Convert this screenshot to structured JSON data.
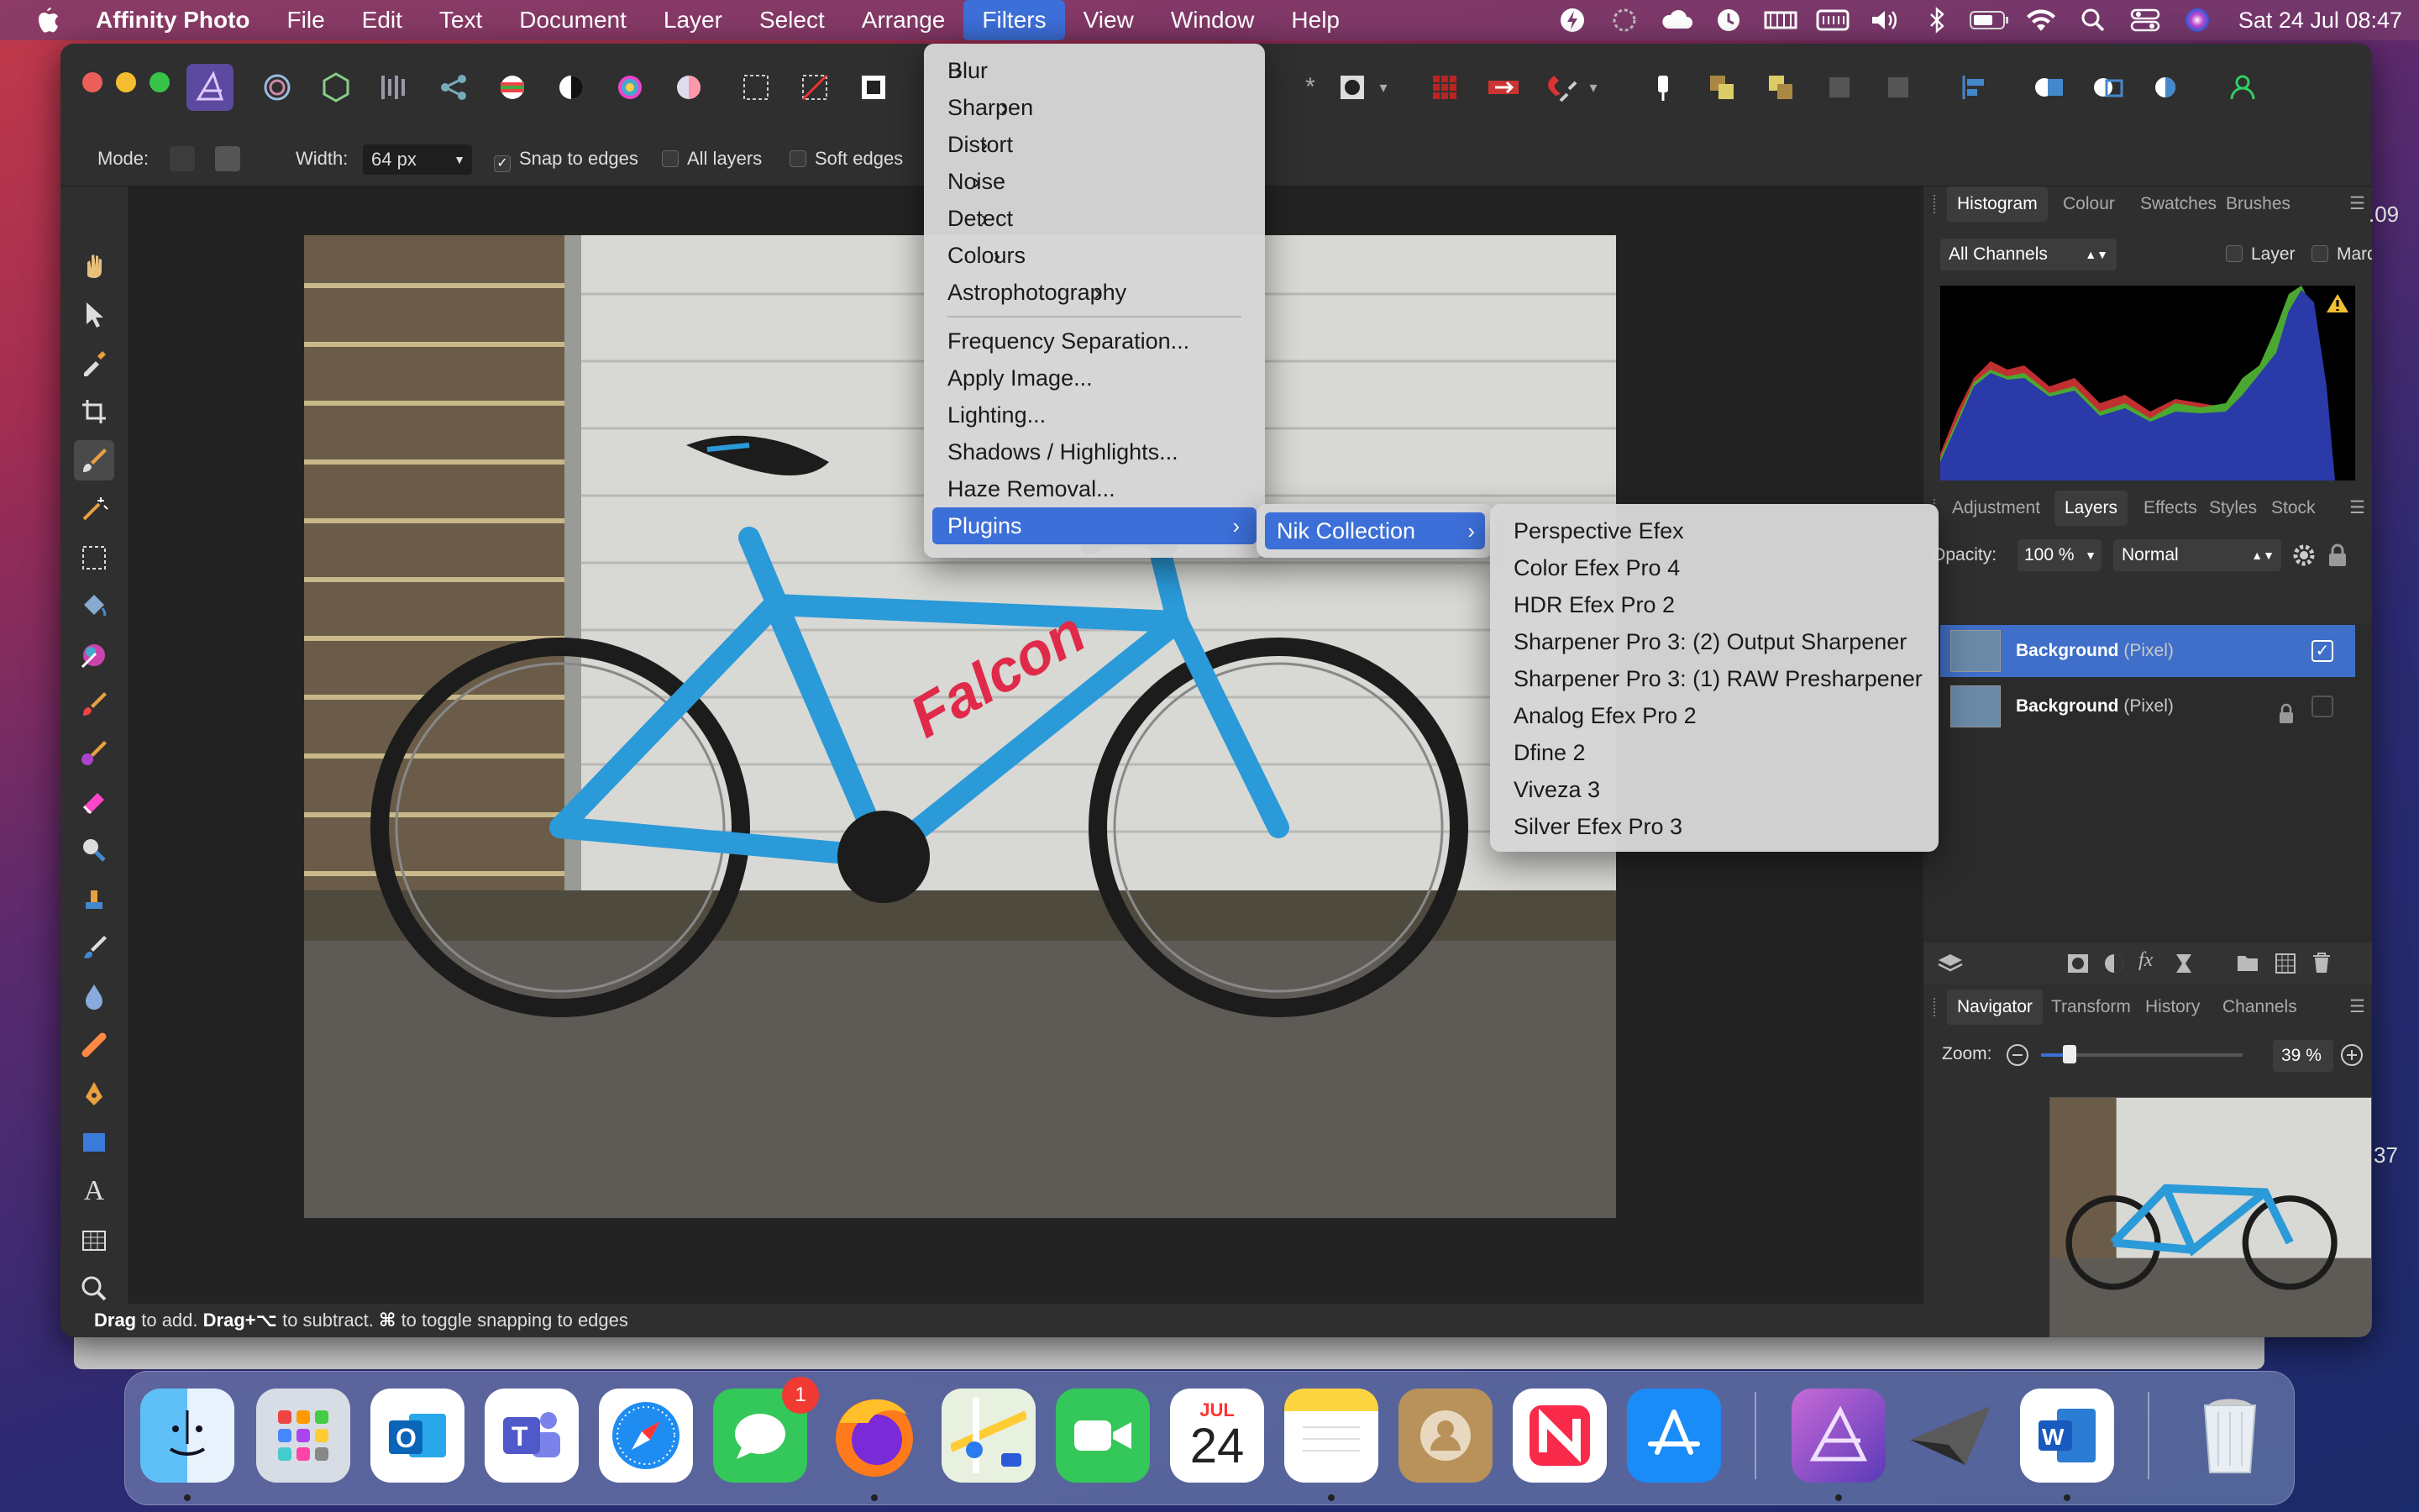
{
  "menubar": {
    "app_name": "Affinity Photo",
    "items": [
      "File",
      "Edit",
      "Text",
      "Document",
      "Layer",
      "Select",
      "Arrange",
      "Filters",
      "View",
      "Window",
      "Help"
    ],
    "active": "Filters",
    "clock": "Sat 24 Jul  08:47",
    "status_icons": [
      "lightning-icon",
      "moon-icon",
      "cloud-icon",
      "clock-icon",
      "flag-icon",
      "battery-box-icon",
      "volume-icon",
      "bluetooth-icon",
      "battery-icon",
      "wifi-icon",
      "search-icon",
      "control-center-icon",
      "siri-icon"
    ]
  },
  "context_toolbar": {
    "mode_label": "Mode:",
    "width_label": "Width:",
    "width_value": "64 px",
    "snap_label": "Snap to edges",
    "snap_checked": true,
    "all_layers_label": "All layers",
    "soft_edges_label": "Soft edges"
  },
  "filters_menu": {
    "items": [
      {
        "label": "Blur",
        "submenu": true
      },
      {
        "label": "Sharpen",
        "submenu": true
      },
      {
        "label": "Distort",
        "submenu": true
      },
      {
        "label": "Noise",
        "submenu": true
      },
      {
        "label": "Detect",
        "submenu": true
      },
      {
        "label": "Colours",
        "submenu": true
      },
      {
        "label": "Astrophotography",
        "submenu": true
      },
      {
        "label": "Frequency Separation...",
        "submenu": false
      },
      {
        "label": "Apply Image...",
        "submenu": false
      },
      {
        "label": "Lighting...",
        "submenu": false
      },
      {
        "label": "Shadows / Highlights...",
        "submenu": false
      },
      {
        "label": "Haze Removal...",
        "submenu": false
      },
      {
        "label": "Plugins",
        "submenu": true
      }
    ],
    "highlighted": "Plugins"
  },
  "plugins_menu": {
    "items": [
      {
        "label": "Nik Collection",
        "submenu": true
      }
    ],
    "highlighted": "Nik Collection"
  },
  "nik_menu": {
    "items": [
      "Perspective Efex",
      "Color Efex Pro 4",
      "HDR Efex Pro 2",
      "Sharpener Pro 3: (2) Output Sharpener",
      "Sharpener Pro 3: (1) RAW Presharpener",
      "Analog Efex Pro 2",
      "Dfine 2",
      "Viveza 3",
      "Silver Efex Pro 3"
    ]
  },
  "histogram_panel": {
    "tabs": [
      "Histogram",
      "Colour",
      "Swatches",
      "Brushes"
    ],
    "active_tab": "Histogram",
    "channels_value": "All Channels",
    "layer_label": "Layer",
    "marquee_label": "Marquee",
    "warning_icon": "warning-icon"
  },
  "layers_panel": {
    "tabs": [
      "Adjustment",
      "Layers",
      "Effects",
      "Styles",
      "Stock"
    ],
    "active_tab": "Layers",
    "opacity_label": "Opacity:",
    "opacity_value": "100 %",
    "blend_mode": "Normal",
    "layers": [
      {
        "name": "Background",
        "type": "(Pixel)",
        "selected": true,
        "visible": true,
        "locked": false
      },
      {
        "name": "Background",
        "type": "(Pixel)",
        "selected": false,
        "visible": false,
        "locked": true
      }
    ]
  },
  "navigator_panel": {
    "tabs": [
      "Navigator",
      "Transform",
      "History",
      "Channels"
    ],
    "active_tab": "Navigator",
    "zoom_label": "Zoom:",
    "zoom_value": "39 %"
  },
  "status_bar": {
    "drag": "Drag",
    "t1": " to add. ",
    "drag2": "Drag+⌥",
    "t2": " to subtract. ",
    "cmd": "⌘",
    "t3": " to toggle snapping to edges"
  },
  "edge_numbers": {
    "top": ".09",
    "bottom": "37"
  },
  "dock": {
    "apps": [
      "Finder",
      "Launchpad",
      "Outlook",
      "Teams",
      "Safari",
      "Messages",
      "Firefox",
      "Maps",
      "FaceTime",
      "Calendar",
      "Notes",
      "Contacts",
      "News",
      "App Store",
      "Affinity Photo",
      "Vectorworks",
      "Word",
      "Trash"
    ],
    "messages_badge": "1",
    "calendar_month": "JUL",
    "calendar_day": "24"
  },
  "colors": {
    "accent": "#3d6fd8",
    "menu_bg": "#d6d6d6",
    "panel_bg": "#2f2f2f"
  }
}
